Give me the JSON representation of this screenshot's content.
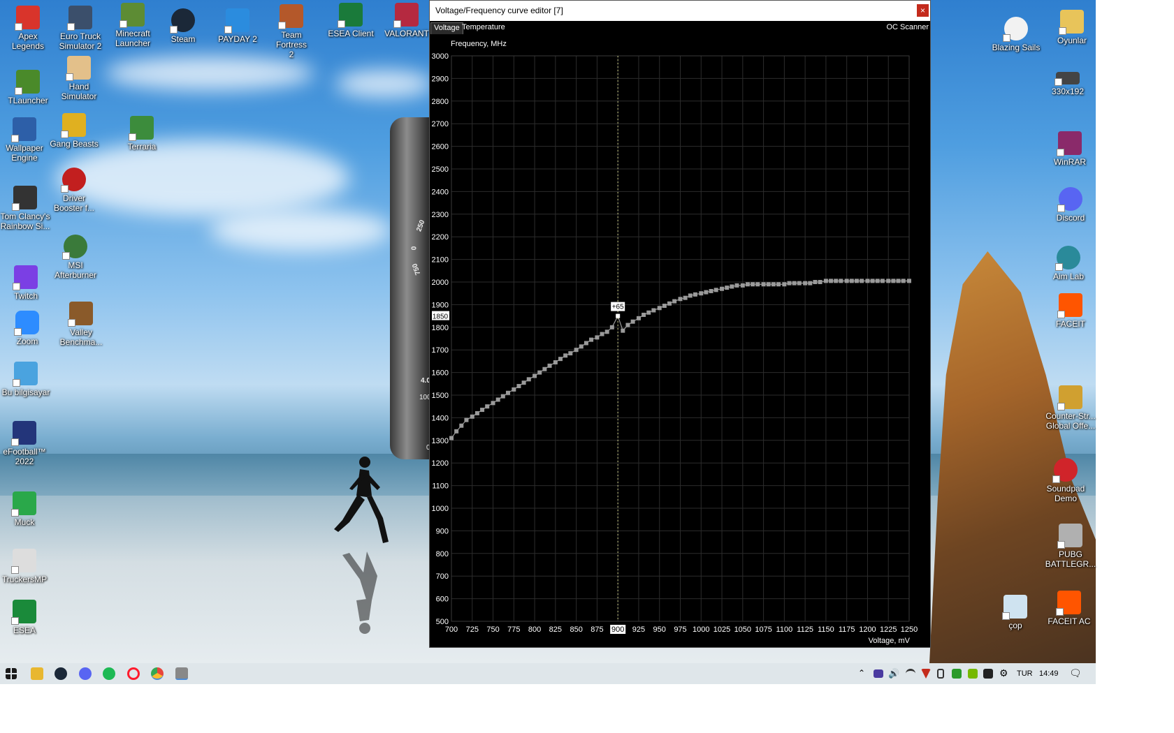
{
  "desktop": {
    "icons_left": [
      {
        "label": "Apex\nLegends",
        "color": "#d9342b"
      },
      {
        "label": "Euro Truck\nSimulator 2",
        "color": "#3b4f6b"
      },
      {
        "label": "Minecraft\nLauncher",
        "color": "#5d8c34"
      },
      {
        "label": "Steam",
        "color": "#1b2838"
      },
      {
        "label": "PAYDAY 2",
        "color": "#2b8cde"
      },
      {
        "label": "Team Fortress\n2",
        "color": "#b4582a"
      },
      {
        "label": "ESEA Client",
        "color": "#1a7a3a"
      },
      {
        "label": "VALORANT",
        "color": "#b52940"
      },
      {
        "label": "TLauncher",
        "color": "#4a8a2a"
      },
      {
        "label": "Hand\nSimulator",
        "color": "#e3c08a"
      },
      {
        "label": "Wallpaper\nEngine",
        "color": "#2d5fa8"
      },
      {
        "label": "Gang Beasts",
        "color": "#e0b020"
      },
      {
        "label": "Terraria",
        "color": "#3c8c3c"
      },
      {
        "label": "Tom Clancy's\nRainbow Si...",
        "color": "#333333"
      },
      {
        "label": "Driver\nBooster f...",
        "color": "#c21f1f"
      },
      {
        "label": "MSI\nAfterburner",
        "color": "#3a7a3a"
      },
      {
        "label": "Twitch",
        "color": "#7b3fe4"
      },
      {
        "label": "Valley\nBenchma...",
        "color": "#8a5a2a"
      },
      {
        "label": "Zoom",
        "color": "#2d8cff"
      },
      {
        "label": "Bu bilgisayar",
        "color": "#4aa3df"
      },
      {
        "label": "eFootball™\n2022",
        "color": "#23357a"
      },
      {
        "label": "Muck",
        "color": "#2aa84a"
      },
      {
        "label": "TruckersMP",
        "color": "#dddddd"
      },
      {
        "label": "ESEA",
        "color": "#1a8a3a"
      }
    ],
    "icons_right": [
      {
        "label": "Blazing Sails",
        "color": "#f2f2f2"
      },
      {
        "label": "Oyunlar",
        "color": "#e8c45a"
      },
      {
        "label": "330x192",
        "color": "#444444"
      },
      {
        "label": "WinRAR",
        "color": "#8a2a6a"
      },
      {
        "label": "Discord",
        "color": "#5865f2"
      },
      {
        "label": "Aim Lab",
        "color": "#2a8a9a"
      },
      {
        "label": "FACEIT",
        "color": "#ff5500"
      },
      {
        "label": "Counter-Str...\nGlobal Offe...",
        "color": "#d0a030"
      },
      {
        "label": "Soundpad\nDemo",
        "color": "#d0242a"
      },
      {
        "label": "PUBG\nBATTLEGR...",
        "color": "#b0b0b0"
      },
      {
        "label": "çop",
        "color": "#cfe3f0"
      },
      {
        "label": "FACEIT AC",
        "color": "#ff5500"
      }
    ]
  },
  "afterburner_skin": {
    "gauge_labels": [
      "250",
      "0",
      "750",
      "4.0",
      "100",
      "0"
    ]
  },
  "window": {
    "title": "Voltage/Frequency curve editor [7]",
    "close_label": "×",
    "tabs": [
      {
        "label": "Voltage",
        "active": true
      },
      {
        "label": "Temperature",
        "active": false
      }
    ],
    "oc_scanner_label": "OC Scanner"
  },
  "chart_data": {
    "type": "line",
    "ylabel": "Frequency, MHz",
    "xlabel": "Voltage, mV",
    "xlim": [
      700,
      1250
    ],
    "ylim": [
      500,
      3000
    ],
    "x_ticks": [
      700,
      725,
      750,
      775,
      800,
      825,
      850,
      875,
      900,
      925,
      950,
      975,
      1000,
      1025,
      1050,
      1075,
      1100,
      1125,
      1150,
      1175,
      1200,
      1225,
      1250
    ],
    "y_ticks": [
      500,
      600,
      700,
      800,
      900,
      1000,
      1100,
      1200,
      1300,
      1400,
      1500,
      1600,
      1700,
      1800,
      1900,
      2000,
      2100,
      2200,
      2300,
      2400,
      2500,
      2600,
      2700,
      2800,
      2900,
      3000
    ],
    "grid": true,
    "series": [
      {
        "color": "#9a9a9a",
        "points": [
          [
            700,
            1310
          ],
          [
            706,
            1340
          ],
          [
            712,
            1365
          ],
          [
            718,
            1390
          ],
          [
            725,
            1405
          ],
          [
            731,
            1420
          ],
          [
            737,
            1435
          ],
          [
            743,
            1450
          ],
          [
            750,
            1465
          ],
          [
            756,
            1480
          ],
          [
            762,
            1495
          ],
          [
            768,
            1510
          ],
          [
            775,
            1525
          ],
          [
            781,
            1540
          ],
          [
            787,
            1555
          ],
          [
            793,
            1570
          ],
          [
            800,
            1585
          ],
          [
            806,
            1600
          ],
          [
            812,
            1615
          ],
          [
            818,
            1630
          ],
          [
            825,
            1645
          ],
          [
            831,
            1660
          ],
          [
            837,
            1675
          ],
          [
            843,
            1685
          ],
          [
            850,
            1700
          ],
          [
            856,
            1715
          ],
          [
            862,
            1730
          ],
          [
            868,
            1745
          ],
          [
            875,
            1755
          ],
          [
            881,
            1770
          ],
          [
            887,
            1780
          ],
          [
            893,
            1800
          ],
          [
            900,
            1850
          ],
          [
            906,
            1785
          ],
          [
            912,
            1810
          ],
          [
            918,
            1825
          ],
          [
            925,
            1840
          ],
          [
            931,
            1855
          ],
          [
            937,
            1865
          ],
          [
            943,
            1875
          ],
          [
            950,
            1885
          ],
          [
            956,
            1895
          ],
          [
            962,
            1905
          ],
          [
            968,
            1915
          ],
          [
            975,
            1925
          ],
          [
            981,
            1930
          ],
          [
            987,
            1940
          ],
          [
            993,
            1945
          ],
          [
            1000,
            1950
          ],
          [
            1006,
            1955
          ],
          [
            1012,
            1960
          ],
          [
            1018,
            1965
          ],
          [
            1025,
            1970
          ],
          [
            1031,
            1975
          ],
          [
            1037,
            1980
          ],
          [
            1043,
            1985
          ],
          [
            1050,
            1985
          ],
          [
            1056,
            1990
          ],
          [
            1062,
            1990
          ],
          [
            1068,
            1990
          ],
          [
            1075,
            1990
          ],
          [
            1081,
            1990
          ],
          [
            1087,
            1990
          ],
          [
            1093,
            1990
          ],
          [
            1100,
            1990
          ],
          [
            1106,
            1995
          ],
          [
            1112,
            1995
          ],
          [
            1118,
            1995
          ],
          [
            1125,
            1995
          ],
          [
            1131,
            1995
          ],
          [
            1137,
            2000
          ],
          [
            1143,
            2000
          ],
          [
            1150,
            2005
          ],
          [
            1156,
            2005
          ],
          [
            1162,
            2005
          ],
          [
            1168,
            2005
          ],
          [
            1175,
            2005
          ],
          [
            1181,
            2005
          ],
          [
            1187,
            2005
          ],
          [
            1193,
            2005
          ],
          [
            1200,
            2005
          ],
          [
            1206,
            2005
          ],
          [
            1212,
            2005
          ],
          [
            1218,
            2005
          ],
          [
            1225,
            2005
          ],
          [
            1231,
            2005
          ],
          [
            1237,
            2005
          ],
          [
            1243,
            2005
          ],
          [
            1250,
            2005
          ]
        ]
      }
    ],
    "selected": {
      "x": 900,
      "y": 1850,
      "offset_label": "+65",
      "x_label": "900",
      "y_label": "1850"
    }
  },
  "taskbar": {
    "apps": [
      {
        "name": "start",
        "color": "#1a6fd1"
      },
      {
        "name": "file-explorer",
        "color": "#e8b730"
      },
      {
        "name": "steam",
        "color": "#1b2838"
      },
      {
        "name": "discord",
        "color": "#5865f2"
      },
      {
        "name": "spotify",
        "color": "#1db954"
      },
      {
        "name": "opera",
        "color": "#ff1b2d"
      },
      {
        "name": "chrome",
        "color": "#e8453c"
      },
      {
        "name": "msi-afterburner",
        "color": "#888888"
      }
    ],
    "language": "TUR",
    "time": "14:49"
  }
}
